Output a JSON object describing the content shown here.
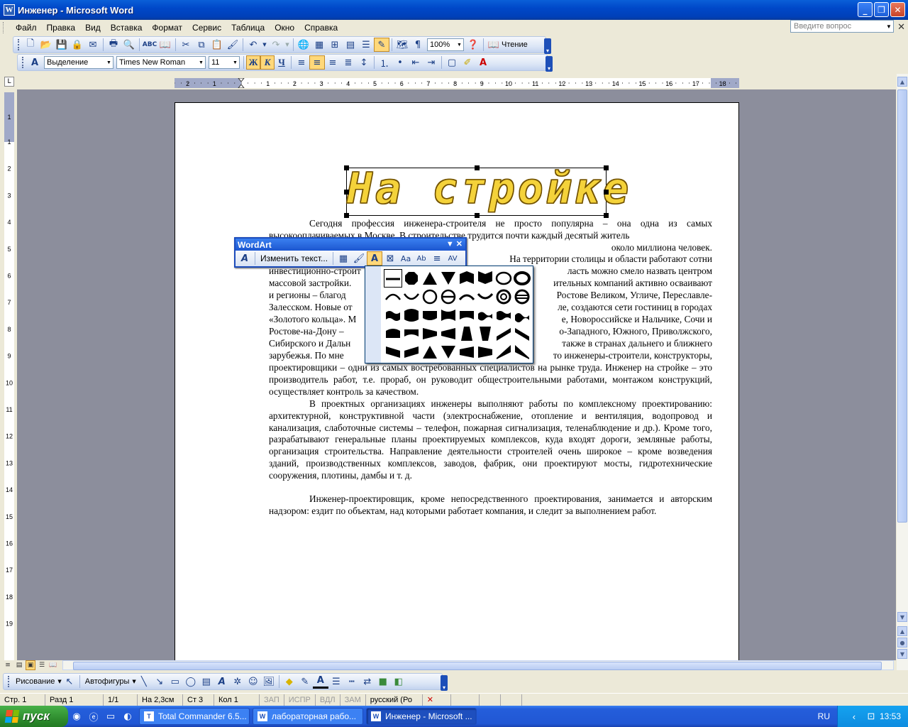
{
  "window": {
    "title": "Инженер - Microsoft Word",
    "app_icon": "W"
  },
  "menu": {
    "items": [
      "Файл",
      "Правка",
      "Вид",
      "Вставка",
      "Формат",
      "Сервис",
      "Таблица",
      "Окно",
      "Справка"
    ],
    "help_placeholder": "Введите вопрос"
  },
  "standard_toolbar": {
    "zoom": "100%",
    "reading_label": "Чтение"
  },
  "formatting_toolbar": {
    "style": "Выделение",
    "font": "Times New Roman",
    "size": "11",
    "bold": "Ж",
    "italic": "К",
    "underline": "Ч"
  },
  "document": {
    "wordart": "На стройке",
    "paragraphs": [
      "Сегодня профессия инженера-строителя не просто популярна – она одна из самых высокооплачиваемых в Москве. В строительстве трудится почти каждый десятый житель",
      "около миллиона человек.",
      "На территории столицы и области работают сотни",
      "инвестиционно-строит",
      "ласть можно смело назвать центром",
      "массовой застройки.",
      "ительных компаний активно осваивают",
      "и регионы – благод",
      "Ростове Великом, Угличе, Переславле-",
      "Залесском. Новые от",
      "ле, создаются сети гостиниц в городах",
      "«Золотого кольца». М",
      "е, Новороссийске и Нальчике, Сочи и",
      "Ростове-на-Дону –",
      "о-Западного, Южного, Приволжского,",
      "Сибирского и Дальн",
      "также в странах дальнего и ближнего",
      "зарубежья. По мне",
      "то инженеры-строители, конструкторы,",
      "проектировщики – одни из самых востребованных специалистов на рынке труда. Инженер на стройке – это производитель работ, т.е. прораб, он руководит общестроительными работами, монтажом конструкций, осуществляет контроль за качеством.",
      "В проектных организациях инженеры выполняют работы по комплексному проектированию: архитектурной, конструктивной части (электроснабжение, отопление и вентиляция, водопровод и канализация, слаботочные системы – телефон, пожарная сигнализация, теленаблюдение и др.). Кроме того, разрабатывают генеральные планы проектируемых комплексов, куда входят дороги, земляные работы, организация строительства. Направление деятельности строителей очень широкое – кроме возведения зданий, производственных комплексов, заводов, фабрик, они проектируют мосты, гидротехнические сооружения, плотины, дамбы и т. д.",
      "Инженер-проектировщик, кроме непосредственного проектирования, занимается и авторским надзором: ездит по объектам, над которыми работает компания, и следит за выполнением работ."
    ]
  },
  "wordart_toolbar": {
    "title": "WordArt",
    "edit_text": "Изменить текст..."
  },
  "ruler": {
    "h_labels": [
      "2",
      "1",
      "1",
      "2",
      "3",
      "4",
      "5",
      "6",
      "7",
      "8",
      "9",
      "10",
      "11",
      "12",
      "13",
      "14",
      "15",
      "16",
      "17",
      "18"
    ],
    "v_labels": [
      "1",
      "1",
      "2",
      "3",
      "4",
      "5",
      "6",
      "7",
      "8",
      "9",
      "10",
      "11",
      "12",
      "13",
      "14",
      "15",
      "16",
      "17",
      "18",
      "19"
    ]
  },
  "drawing_toolbar": {
    "draw_label": "Рисование",
    "autoshapes_label": "Автофигуры"
  },
  "status": {
    "page": "Стр. 1",
    "section": "Разд 1",
    "pages": "1/1",
    "at": "На 2,3см",
    "line": "Ст 3",
    "col": "Кол 1",
    "rec": "ЗАП",
    "trk": "ИСПР",
    "ext": "ВДЛ",
    "ovr": "ЗАМ",
    "lang": "русский (Ро"
  },
  "taskbar": {
    "start": "пуск",
    "tasks": [
      "Total Commander 6.5...",
      "лабораторная рабо...",
      "Инженер - Microsoft ..."
    ],
    "lang": "RU",
    "clock": "13:53"
  }
}
